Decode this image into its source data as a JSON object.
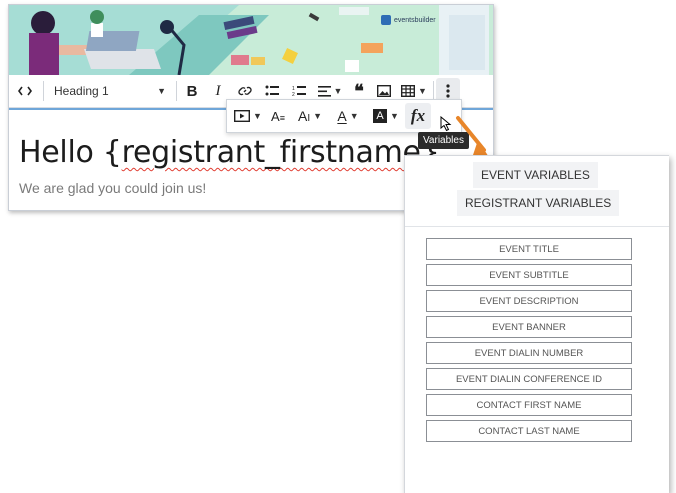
{
  "banner": {
    "logo_text": "eventsbuilder"
  },
  "toolbar": {
    "source_icon": "code-icon",
    "heading_select": "Heading 1",
    "bold_label": "B",
    "italic_label": "I"
  },
  "toolbar2": {
    "fx_label": "fx"
  },
  "tooltip": {
    "text": "Variables"
  },
  "editor": {
    "greeting_prefix": "Hello {",
    "greeting_var": "registrant_firstname",
    "greeting_suffix": "},",
    "subtitle": "We are glad you could join us!"
  },
  "panel": {
    "tabs": [
      "EVENT VARIABLES",
      "REGISTRANT VARIABLES"
    ],
    "variables": [
      "EVENT TITLE",
      "EVENT SUBTITLE",
      "EVENT DESCRIPTION",
      "EVENT BANNER",
      "EVENT DIALIN NUMBER",
      "EVENT DIALIN CONFERENCE ID",
      "CONTACT FIRST NAME",
      "CONTACT LAST NAME"
    ]
  },
  "colors": {
    "accent_arrow": "#e8862a",
    "focus_border": "#6fa6d9",
    "banner_bg": "#9ed9d2"
  }
}
